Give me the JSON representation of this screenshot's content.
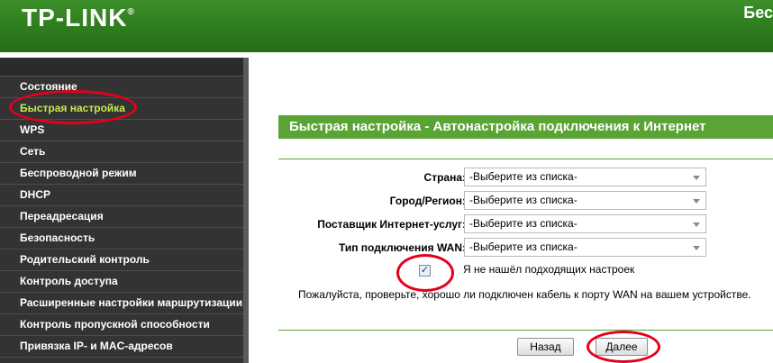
{
  "header": {
    "logo": "TP-LINK",
    "logo_mark": "®",
    "right_text": "Бес"
  },
  "sidebar": {
    "items": [
      {
        "label": "Состояние"
      },
      {
        "label": "Быстрая настройка",
        "active": true
      },
      {
        "label": "WPS"
      },
      {
        "label": "Сеть"
      },
      {
        "label": "Беспроводной режим"
      },
      {
        "label": "DHCP"
      },
      {
        "label": "Переадресация"
      },
      {
        "label": "Безопасность"
      },
      {
        "label": "Родительский контроль"
      },
      {
        "label": "Контроль доступа"
      },
      {
        "label": "Расширенные настройки маршрутизации"
      },
      {
        "label": "Контроль пропускной способности"
      },
      {
        "label": "Привязка IP- и MAC-адресов"
      }
    ]
  },
  "main": {
    "title": "Быстрая настройка - Автонастройка подключения к Интернет",
    "fields": [
      {
        "label": "Страна:",
        "value": "-Выберите из списка-"
      },
      {
        "label": "Город/Регион:",
        "value": "-Выберите из списка-"
      },
      {
        "label": "Поставщик Интернет-услуг:",
        "value": "-Выберите из списка-"
      },
      {
        "label": "Тип подключения WAN:",
        "value": "-Выберите из списка-"
      }
    ],
    "checkbox_label": "Я не нашёл подходящих настроек",
    "checkbox_checked": true,
    "check_mark": "✓",
    "note": "Пожалуйста, проверьте, хорошо ли подключен кабель к порту WAN на вашем устройстве.",
    "back_button": "Назад",
    "next_button": "Далее"
  },
  "colors": {
    "header_green": "#2c7a1c",
    "title_green": "#5aa335",
    "sidebar_bg": "#333333",
    "active_item": "#c6e84f",
    "annotation_red": "#e3001b"
  }
}
